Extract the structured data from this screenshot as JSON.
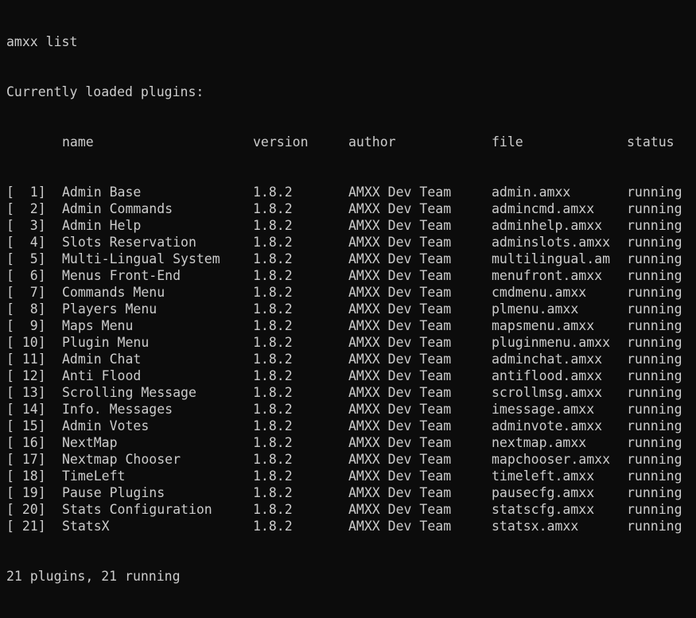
{
  "terminal": {
    "command": "amxx list",
    "heading": "Currently loaded plugins:",
    "columns": {
      "name": "name",
      "version": "version",
      "author": "author",
      "file": "file",
      "status": "status"
    },
    "rows": [
      {
        "index": "[  1]",
        "name": "Admin Base",
        "version": "1.8.2",
        "author": "AMXX Dev Team",
        "file": "admin.amxx",
        "status": "running"
      },
      {
        "index": "[  2]",
        "name": "Admin Commands",
        "version": "1.8.2",
        "author": "AMXX Dev Team",
        "file": "admincmd.amxx",
        "status": "running"
      },
      {
        "index": "[  3]",
        "name": "Admin Help",
        "version": "1.8.2",
        "author": "AMXX Dev Team",
        "file": "adminhelp.amxx",
        "status": "running"
      },
      {
        "index": "[  4]",
        "name": "Slots Reservation",
        "version": "1.8.2",
        "author": "AMXX Dev Team",
        "file": "adminslots.amxx",
        "status": "running"
      },
      {
        "index": "[  5]",
        "name": "Multi-Lingual System",
        "version": "1.8.2",
        "author": "AMXX Dev Team",
        "file": "multilingual.am",
        "status": "running"
      },
      {
        "index": "[  6]",
        "name": "Menus Front-End",
        "version": "1.8.2",
        "author": "AMXX Dev Team",
        "file": "menufront.amxx",
        "status": "running"
      },
      {
        "index": "[  7]",
        "name": "Commands Menu",
        "version": "1.8.2",
        "author": "AMXX Dev Team",
        "file": "cmdmenu.amxx",
        "status": "running"
      },
      {
        "index": "[  8]",
        "name": "Players Menu",
        "version": "1.8.2",
        "author": "AMXX Dev Team",
        "file": "plmenu.amxx",
        "status": "running"
      },
      {
        "index": "[  9]",
        "name": "Maps Menu",
        "version": "1.8.2",
        "author": "AMXX Dev Team",
        "file": "mapsmenu.amxx",
        "status": "running"
      },
      {
        "index": "[ 10]",
        "name": "Plugin Menu",
        "version": "1.8.2",
        "author": "AMXX Dev Team",
        "file": "pluginmenu.amxx",
        "status": "running"
      },
      {
        "index": "[ 11]",
        "name": "Admin Chat",
        "version": "1.8.2",
        "author": "AMXX Dev Team",
        "file": "adminchat.amxx",
        "status": "running"
      },
      {
        "index": "[ 12]",
        "name": "Anti Flood",
        "version": "1.8.2",
        "author": "AMXX Dev Team",
        "file": "antiflood.amxx",
        "status": "running"
      },
      {
        "index": "[ 13]",
        "name": "Scrolling Message",
        "version": "1.8.2",
        "author": "AMXX Dev Team",
        "file": "scrollmsg.amxx",
        "status": "running"
      },
      {
        "index": "[ 14]",
        "name": "Info. Messages",
        "version": "1.8.2",
        "author": "AMXX Dev Team",
        "file": "imessage.amxx",
        "status": "running"
      },
      {
        "index": "[ 15]",
        "name": "Admin Votes",
        "version": "1.8.2",
        "author": "AMXX Dev Team",
        "file": "adminvote.amxx",
        "status": "running"
      },
      {
        "index": "[ 16]",
        "name": "NextMap",
        "version": "1.8.2",
        "author": "AMXX Dev Team",
        "file": "nextmap.amxx",
        "status": "running"
      },
      {
        "index": "[ 17]",
        "name": "Nextmap Chooser",
        "version": "1.8.2",
        "author": "AMXX Dev Team",
        "file": "mapchooser.amxx",
        "status": "running"
      },
      {
        "index": "[ 18]",
        "name": "TimeLeft",
        "version": "1.8.2",
        "author": "AMXX Dev Team",
        "file": "timeleft.amxx",
        "status": "running"
      },
      {
        "index": "[ 19]",
        "name": "Pause Plugins",
        "version": "1.8.2",
        "author": "AMXX Dev Team",
        "file": "pausecfg.amxx",
        "status": "running"
      },
      {
        "index": "[ 20]",
        "name": "Stats Configuration",
        "version": "1.8.2",
        "author": "AMXX Dev Team",
        "file": "statscfg.amxx",
        "status": "running"
      },
      {
        "index": "[ 21]",
        "name": "StatsX",
        "version": "1.8.2",
        "author": "AMXX Dev Team",
        "file": "statsx.amxx",
        "status": "running"
      }
    ],
    "summary": "21 plugins, 21 running"
  },
  "colors": {
    "background": "#0c0c0c",
    "text": "#cccccc"
  }
}
